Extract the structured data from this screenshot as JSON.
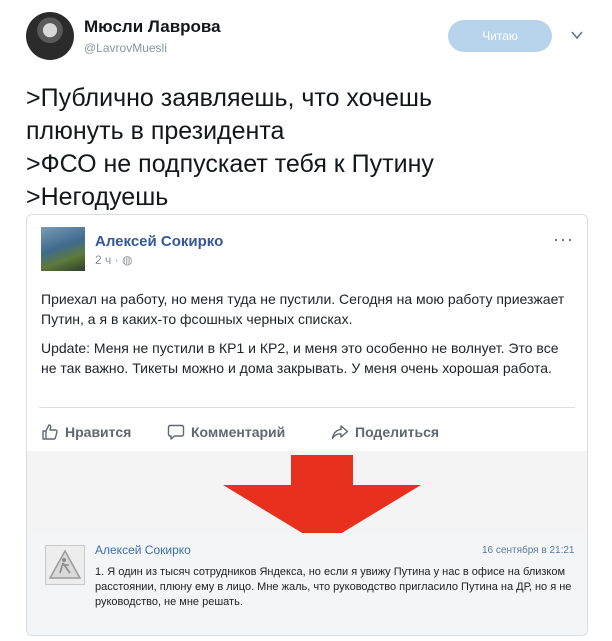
{
  "tweet": {
    "author_name": "Мюсли Лаврова",
    "author_handle": "@LavrovMuesli",
    "follow_label": "Читаю",
    "lines": [
      ">Публично заявляешь, что хочешь",
      "плюнуть в президента",
      ">ФСО не подпускает тебя к Путину",
      ">Негодуешь"
    ]
  },
  "fb_post": {
    "author": "Алексей Сокирко",
    "meta": "2 ч · ",
    "more_icon": "ellipsis-icon",
    "paragraphs": [
      "Приехал на работу, но меня туда не пустили. Сегодня на мою работу приезжает Путин, а я в каких-то фсошных черных списках.",
      "Update: Меня не пустили в КР1 и КР2, и меня это особенно не волнует. Это все не так важно. Тикеты можно и дома закрывать. У меня очень хорошая работа."
    ],
    "actions": {
      "like": "Нравится",
      "comment": "Комментарий",
      "share": "Поделиться"
    }
  },
  "arrow_color": "#e8301f",
  "comment": {
    "author": "Алексей Сокирко",
    "date": "16 сентября в 21:21",
    "text": "1. Я один из тысяч сотрудников Яндекса, но если я увижу Путина у нас в офисе на близком расстоянии, плюну ему в лицо. Мне жаль, что руководство пригласило Путина на ДР, но я не руководство, не мне решать."
  },
  "colors": {
    "follow_bg": "#b8d4ec",
    "fb_link": "#365899",
    "comment_link": "#3e6fa8"
  }
}
